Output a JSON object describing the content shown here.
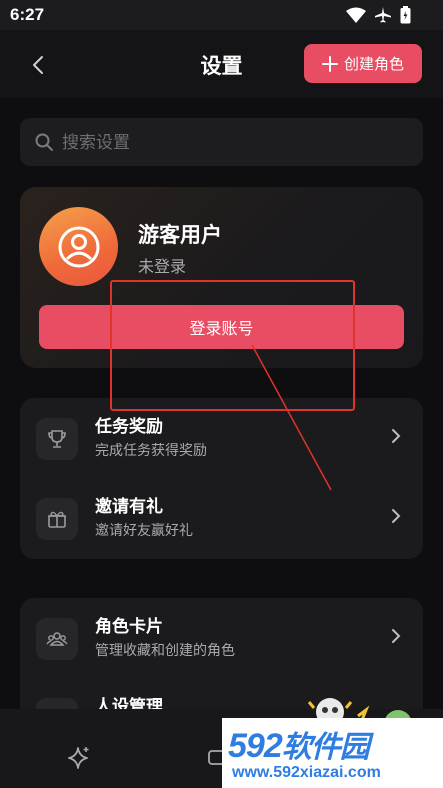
{
  "status_bar": {
    "time": "6:27"
  },
  "header": {
    "title": "设置",
    "create_label": "创建角色"
  },
  "search": {
    "placeholder": "搜索设置"
  },
  "profile": {
    "name": "游客用户",
    "status": "未登录",
    "login_label": "登录账号"
  },
  "group1": [
    {
      "title": "任务奖励",
      "subtitle": "完成任务获得奖励",
      "icon": "trophy-icon"
    },
    {
      "title": "邀请有礼",
      "subtitle": "邀请好友赢好礼",
      "icon": "gift-icon"
    }
  ],
  "group2": [
    {
      "title": "角色卡片",
      "subtitle": "管理收藏和创建的角色",
      "icon": "people-icon"
    },
    {
      "title": "人设管理",
      "subtitle": "",
      "icon": "persona-icon"
    }
  ],
  "watermark": {
    "brand_number": "592",
    "brand_text": "软件园",
    "url": "www.592xiazai.com"
  },
  "colors": {
    "accent": "#e84d63",
    "background": "#0e0e10",
    "card": "#1b1b1d",
    "annotation": "#e0332a",
    "watermark": "#2f7de1"
  }
}
